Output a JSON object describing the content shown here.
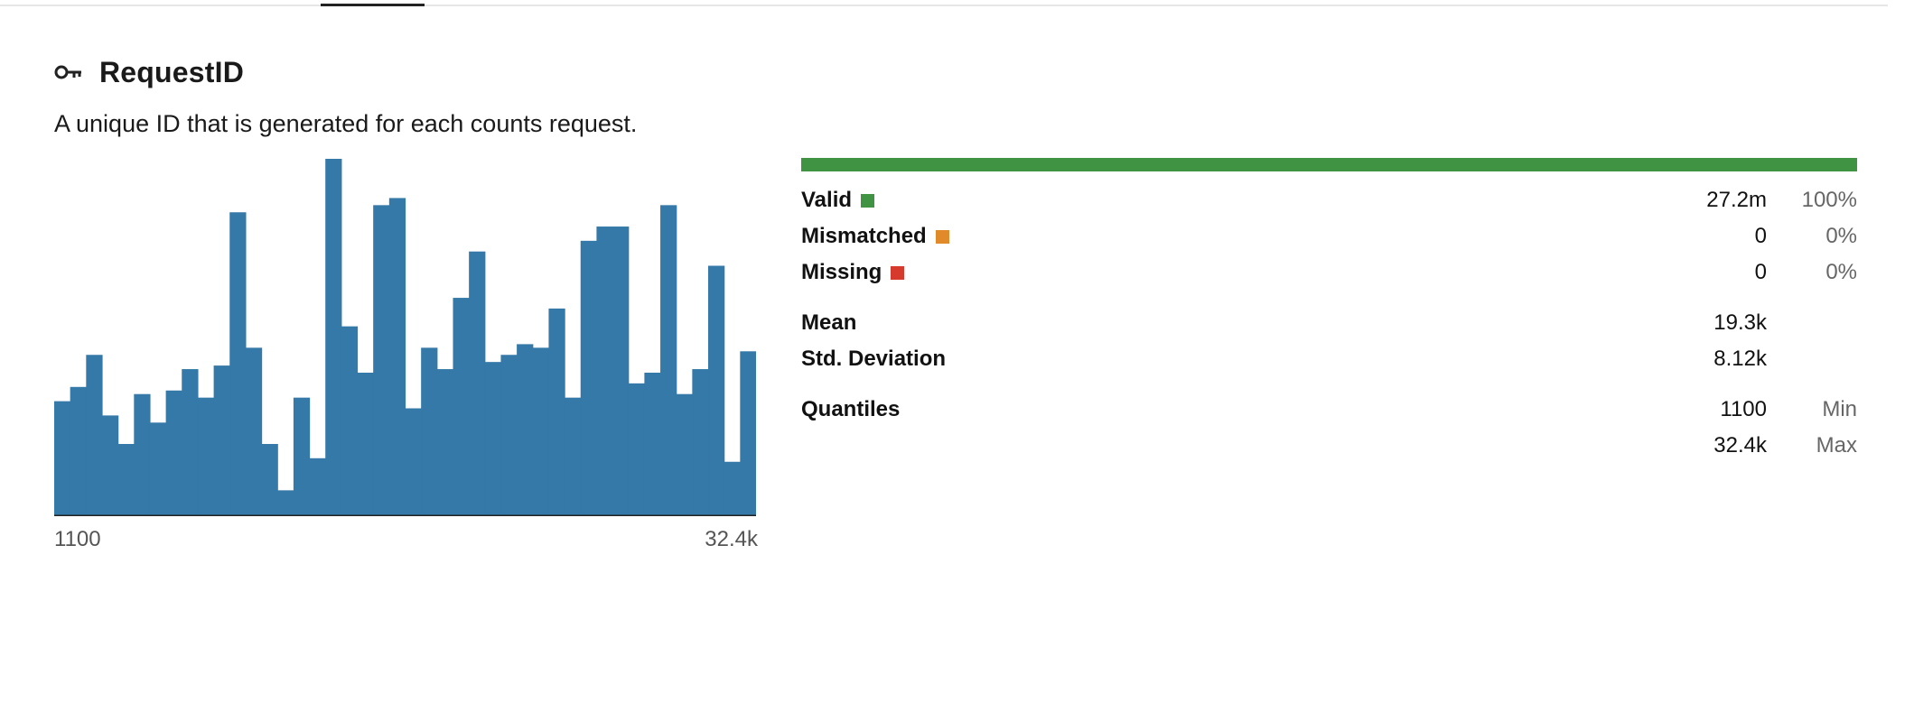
{
  "field": {
    "title": "RequestID",
    "description": "A unique ID that is generated for each counts request.",
    "icon": "key-icon"
  },
  "histogram": {
    "min_label": "1100",
    "max_label": "32.4k",
    "bar_color": "#3579a8"
  },
  "chart_data": {
    "type": "bar",
    "values": [
      32,
      36,
      45,
      28,
      20,
      34,
      26,
      35,
      41,
      33,
      42,
      85,
      47,
      20,
      7,
      33,
      16,
      100,
      53,
      40,
      87,
      89,
      30,
      47,
      41,
      61,
      74,
      43,
      45,
      48,
      47,
      58,
      33,
      77,
      81,
      81,
      37,
      40,
      87,
      34,
      41,
      70,
      15,
      46
    ],
    "title": "",
    "xlabel": "",
    "ylabel": "",
    "x_range": [
      "1100",
      "32.4k"
    ]
  },
  "summary": {
    "valid_fraction": 1.0,
    "colors": {
      "valid": "#3f9343",
      "mismatched": "#e08a2a",
      "missing": "#d63a2c"
    },
    "rows": {
      "valid": {
        "label": "Valid",
        "value": "27.2m",
        "pct": "100%"
      },
      "mismatched": {
        "label": "Mismatched",
        "value": "0",
        "pct": "0%"
      },
      "missing": {
        "label": "Missing",
        "value": "0",
        "pct": "0%"
      },
      "mean": {
        "label": "Mean",
        "value": "19.3k"
      },
      "std": {
        "label": "Std. Deviation",
        "value": "8.12k"
      },
      "quantiles": {
        "label": "Quantiles",
        "min_value": "1100",
        "min_label": "Min",
        "max_value": "32.4k",
        "max_label": "Max"
      }
    }
  }
}
